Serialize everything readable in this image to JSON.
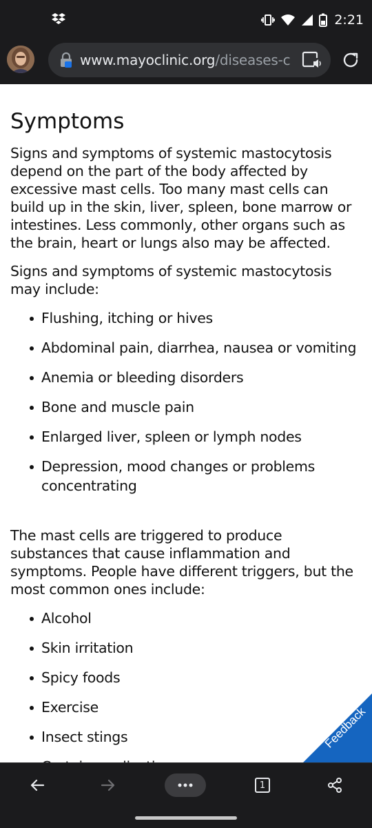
{
  "status_bar": {
    "time": "2:21",
    "left_icon": "dropbox-icon",
    "icons": [
      "vibrate-icon",
      "wifi-icon",
      "signal-icon",
      "battery-icon"
    ]
  },
  "address_bar": {
    "url_domain": "www.mayoclinic.org",
    "url_path": "/diseases-conditions",
    "icons": [
      "avatar",
      "lock-icon",
      "reader-mode-icon",
      "reload-icon"
    ]
  },
  "article": {
    "heading": "Symptoms",
    "intro": "Signs and symptoms of systemic mastocytosis depend on the part of the body affected by excessive mast cells. Too many mast cells can build up in the skin, liver, spleen, bone marrow or intestines. Less commonly, other organs such as the brain, heart or lungs also may be affected.",
    "list_intro": "Signs and symptoms of systemic mastocytosis may include:",
    "symptoms": [
      "Flushing, itching or hives",
      "Abdominal pain, diarrhea, nausea or vomiting",
      "Anemia or bleeding disorders",
      "Bone and muscle pain",
      "Enlarged liver, spleen or lymph nodes",
      "Depression, mood changes or problems concentrating"
    ],
    "triggers_intro": "The mast cells are triggered to produce substances that cause inflammation and symptoms. People have different triggers, but the most common ones include:",
    "triggers": [
      "Alcohol",
      "Skin irritation",
      "Spicy foods",
      "Exercise",
      "Insect stings",
      "Certain medications"
    ]
  },
  "feedback": {
    "label": "Feedback",
    "color": "#1565c0"
  },
  "toolbar": {
    "tab_count": "1",
    "icons": [
      "back-arrow-icon",
      "forward-arrow-icon",
      "more-menu-icon",
      "tab-switcher-icon",
      "share-icon"
    ]
  }
}
